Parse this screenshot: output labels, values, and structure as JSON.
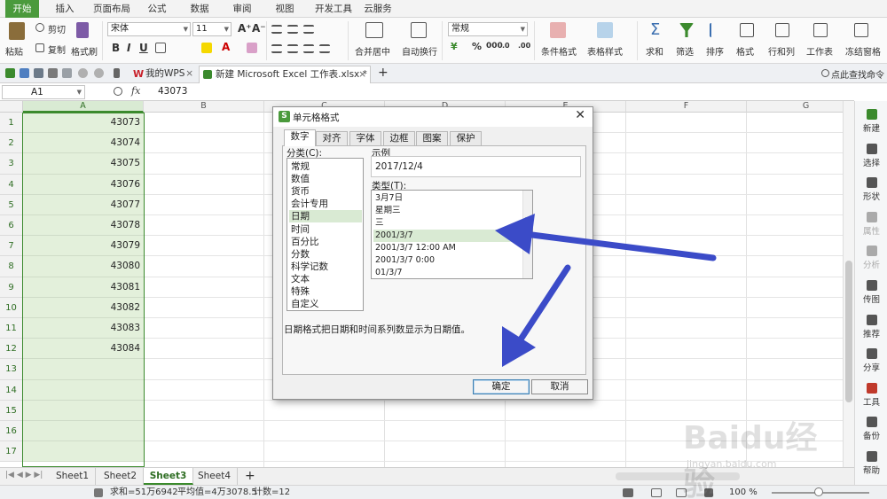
{
  "ribbon": {
    "tabs": [
      {
        "label": "开始",
        "active": true
      },
      {
        "label": "插入"
      },
      {
        "label": "页面布局"
      },
      {
        "label": "公式"
      },
      {
        "label": "数据"
      },
      {
        "label": "审阅"
      },
      {
        "label": "视图"
      },
      {
        "label": "开发工具"
      },
      {
        "label": "云服务"
      }
    ],
    "paste": "粘贴",
    "cut": "剪切",
    "copy": "复制",
    "format_painter": "格式刷",
    "font_name": "宋体",
    "font_size": "11",
    "number_format": "常规",
    "merge_center": "合并居中",
    "wrap_text": "自动换行",
    "conditional_format": "条件格式",
    "table_style": "表格样式",
    "sum": "求和",
    "filter": "筛选",
    "sort": "排序",
    "format": "格式",
    "rows_cols": "行和列",
    "worksheet": "工作表",
    "freeze": "冻结窗格"
  },
  "doc_tabs": {
    "my_wps": "我的WPS",
    "file": "新建 Microsoft Excel 工作表.xlsx *",
    "close": "×",
    "add": "+",
    "search": "点此查找命令"
  },
  "formula_bar": {
    "name_box": "A1",
    "fx": "fx",
    "value": "43073"
  },
  "grid": {
    "columns": [
      "A",
      "B",
      "C",
      "D",
      "E",
      "F",
      "G"
    ],
    "rows": [
      "1",
      "2",
      "3",
      "4",
      "5",
      "6",
      "7",
      "8",
      "9",
      "10",
      "11",
      "12",
      "13",
      "14",
      "15",
      "16",
      "17"
    ],
    "column_a_values": [
      "43073",
      "43074",
      "43075",
      "43076",
      "43077",
      "43078",
      "43079",
      "43080",
      "43081",
      "43082",
      "43083",
      "43084"
    ]
  },
  "sheets": {
    "tabs": [
      "Sheet1",
      "Sheet2",
      "Sheet3",
      "Sheet4"
    ],
    "active": "Sheet3",
    "add": "+"
  },
  "status": {
    "sum": "求和=51万6942",
    "average": "平均值=4万3078.5",
    "count": "计数=12",
    "zoom": "100 %"
  },
  "right_panel": [
    {
      "label": "新建",
      "color": "#3b8a2d"
    },
    {
      "label": "选择",
      "color": "#555555"
    },
    {
      "label": "形状",
      "color": "#555555"
    },
    {
      "label": "属性",
      "color": "#aaaaaa"
    },
    {
      "label": "分析",
      "color": "#aaaaaa"
    },
    {
      "label": "传图",
      "color": "#555555"
    },
    {
      "label": "推荐",
      "color": "#555555"
    },
    {
      "label": "分享",
      "color": "#555555"
    },
    {
      "label": "工具",
      "color": "#c0392b"
    },
    {
      "label": "备份",
      "color": "#555555"
    },
    {
      "label": "帮助",
      "color": "#555555"
    }
  ],
  "dialog": {
    "title": "单元格格式",
    "tabs": [
      "数字",
      "对齐",
      "字体",
      "边框",
      "图案",
      "保护"
    ],
    "category_label": "分类(C):",
    "categories": [
      "常规",
      "数值",
      "货币",
      "会计专用",
      "日期",
      "时间",
      "百分比",
      "分数",
      "科学记数",
      "文本",
      "特殊",
      "自定义"
    ],
    "selected_category": "日期",
    "sample_label": "示例",
    "sample_value": "2017/12/4",
    "type_label": "类型(T):",
    "types": [
      "3月7日",
      "星期三",
      "三",
      "2001/3/7",
      "2001/3/7 12:00 AM",
      "2001/3/7 0:00",
      "01/3/7"
    ],
    "selected_type": "2001/3/7",
    "description": "日期格式把日期和时间系列数显示为日期值。",
    "ok": "确定",
    "cancel": "取消"
  },
  "watermark": {
    "brand": "Baidu经验",
    "url": "jingyan.baidu.com"
  },
  "colors": {
    "accent": "#4a9a3c",
    "selection_fill": "#e3f0db",
    "arrow": "#3b4bc8"
  }
}
